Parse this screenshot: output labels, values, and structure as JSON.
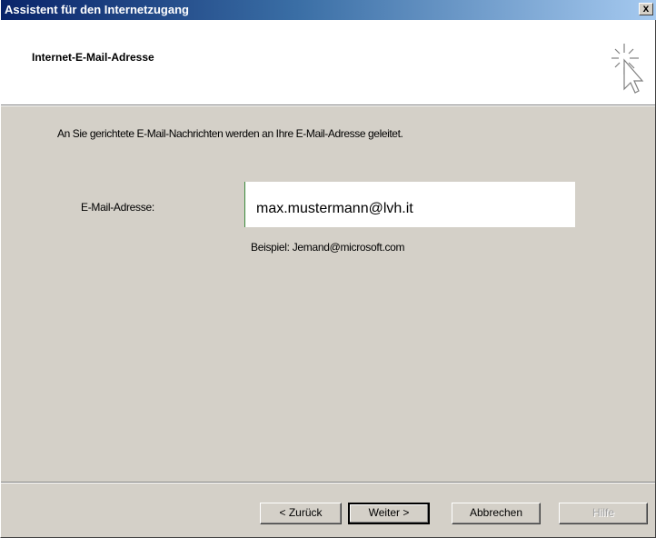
{
  "window": {
    "title": "Assistent für den Internetzugang",
    "close_label": "x"
  },
  "header": {
    "title": "Internet-E-Mail-Adresse",
    "icon": "wizard-cursor-icon"
  },
  "main": {
    "intro": "An Sie gerichtete E-Mail-Nachrichten werden an Ihre E-Mail-Adresse geleitet.",
    "email_label": "E-Mail-Adresse:",
    "email_value": "max.mustermann@lvh.it",
    "example": "Beispiel: Jemand@microsoft.com"
  },
  "buttons": {
    "back": "< Zurück",
    "next": "Weiter >",
    "cancel": "Abbrechen",
    "help": "Hilfe"
  },
  "colors": {
    "titlebar_start": "#0a246a",
    "titlebar_end": "#a6caf0",
    "dialog_bg": "#d4d0c8"
  }
}
